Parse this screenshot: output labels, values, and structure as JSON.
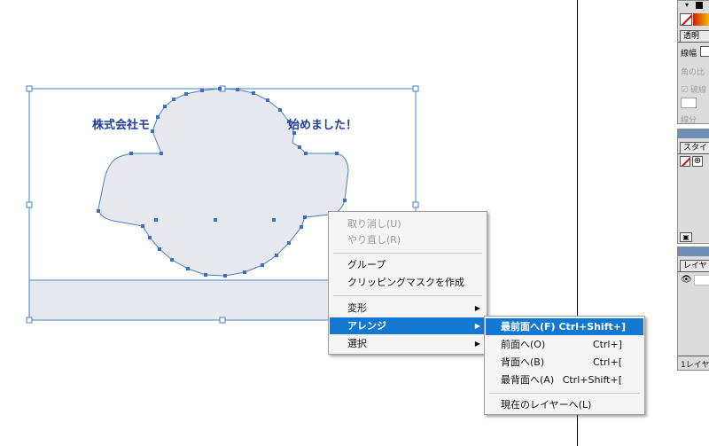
{
  "window": {
    "accent": "#1478d1",
    "selection_color": "#4a7ec9",
    "shape_fill": "#e8e9ef",
    "text_color": "#1f3e9c"
  },
  "artwork": {
    "text_left": "株式会社モ",
    "text_right": "始めました！"
  },
  "context_menu": {
    "items": [
      {
        "label": "取り消し(U)",
        "enabled": false
      },
      {
        "label": "やり直し(R)",
        "enabled": false
      },
      {
        "label": "グループ",
        "enabled": true
      },
      {
        "label": "クリッピングマスクを作成",
        "enabled": true
      },
      {
        "label": "変形",
        "enabled": true,
        "submenu": true
      },
      {
        "label": "アレンジ",
        "enabled": true,
        "submenu": true,
        "active": true
      },
      {
        "label": "選択",
        "enabled": true,
        "submenu": true
      }
    ]
  },
  "arrange_submenu": {
    "items": [
      {
        "label": "最前面へ(F)",
        "shortcut": "Ctrl+Shift+]",
        "active": true
      },
      {
        "label": "前面へ(O)",
        "shortcut": "Ctrl+]"
      },
      {
        "label": "背面へ(B)",
        "shortcut": "Ctrl+["
      },
      {
        "label": "最背面へ(A)",
        "shortcut": "Ctrl+Shift+["
      },
      {
        "label": "現在のレイヤーへ(L)",
        "shortcut": ""
      }
    ]
  },
  "panels": {
    "transparency_tab": "透明",
    "stroke_width_label": "線幅",
    "corner_label": "角の比",
    "dashed_label": "破線",
    "dash_label": "線分",
    "style_tab": "スタイ",
    "layers_tab": "レイヤ",
    "layer_count": "1レイヤ"
  },
  "icons": [
    "no-fill-icon",
    "gradient-swatch-icon",
    "eye-icon",
    "new-style-icon",
    "add-style-icon",
    "panel-menu-icon"
  ]
}
